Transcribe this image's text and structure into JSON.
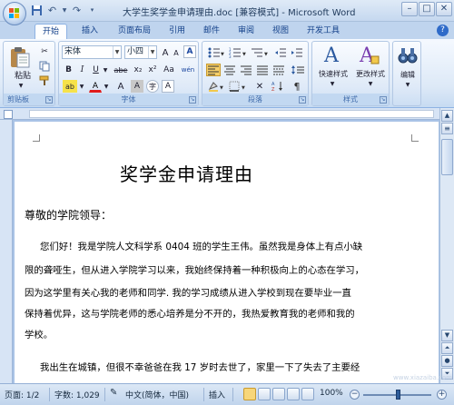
{
  "window": {
    "title": "大学生奖学金申请理由.doc [兼容模式] - Microsoft Word"
  },
  "tabs": [
    "开始",
    "插入",
    "页面布局",
    "引用",
    "邮件",
    "审阅",
    "视图",
    "开发工具"
  ],
  "ribbon": {
    "clipboard": {
      "paste_label": "粘贴",
      "group_label": "剪贴板"
    },
    "font": {
      "font_name": "宋体",
      "font_size": "小四",
      "group_label": "字体",
      "bold": "B",
      "italic": "I",
      "underline": "U",
      "strike": "abe",
      "subscript": "x₂",
      "superscript": "x²",
      "grow": "A",
      "shrink": "A",
      "pinyin": "wén",
      "border_char": "A",
      "clear_format": "A",
      "char_shading": "A",
      "circle_char": "字",
      "font_color": "A",
      "highlight": "ab",
      "case": "Aa"
    },
    "paragraph": {
      "group_label": "段落"
    },
    "styles": {
      "quick_styles": "快速样式",
      "change_styles": "更改样式",
      "group_label": "样式"
    },
    "editing": {
      "label": "编辑"
    }
  },
  "document": {
    "title": "奖学金申请理由",
    "salutation": "尊敬的学院领导：",
    "paragraph1_lines": [
      "您们好！我是学院人文科学系 0404 班的学生王伟。虽然我是身体上有点小缺",
      "限的聋哑生，但从进入学院学习以来，我始终保持着一种积极向上的心态在学习，",
      "因为这学里有关心我的老师和同学. 我的学习成绩从进入学校到现在要毕业一直",
      "保持着优异，这与学院老师的悉心培养是分不开的，我热爱教育我的老师和我的",
      "学校。"
    ],
    "paragraph2_first_line": "我出生在城镇，但很不幸爸爸在我 17 岁时去世了，家里一下了失去了主要经"
  },
  "status": {
    "page": "页面: 1/2",
    "word_count": "字数: 1,029",
    "language": "中文(简体，中国)",
    "insert_mode": "插入",
    "zoom": "100%"
  },
  "watermark": "www.xiazaiba.com",
  "colors": {
    "ribbon_bg": "#dde9f7",
    "accent": "#15428b",
    "canvas": "#a9c3e6"
  }
}
